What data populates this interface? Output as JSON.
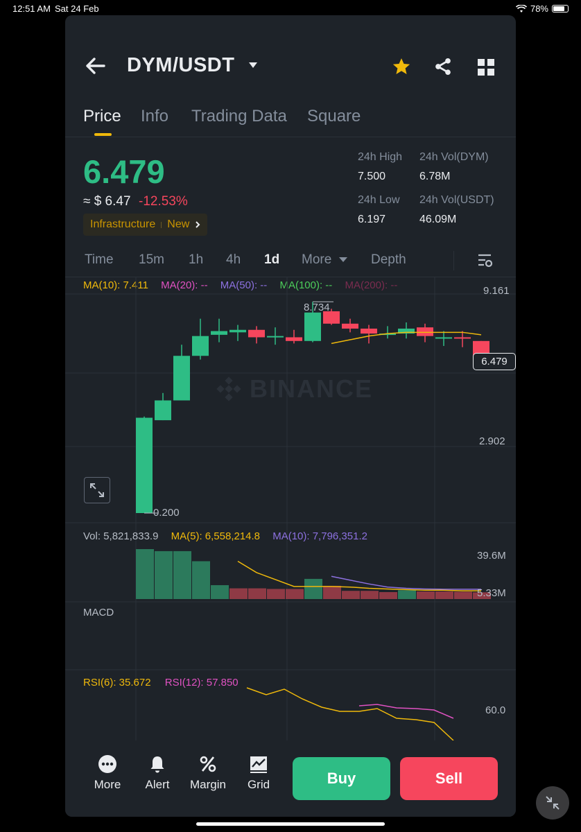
{
  "status": {
    "time": "12:51 AM",
    "date": "Sat 24 Feb",
    "battery": "78%"
  },
  "header": {
    "pair": "DYM/USDT"
  },
  "tabs": [
    "Price",
    "Info",
    "Trading Data",
    "Square"
  ],
  "ticker": {
    "price": "6.479",
    "approx": "≈ $ 6.47",
    "change": "-12.53%",
    "tag_category": "Infrastructure",
    "tag_new": "New",
    "stats": {
      "high_label": "24h High",
      "high_value": "7.500",
      "low_label": "24h Low",
      "low_value": "6.197",
      "vol_base_label": "24h Vol(DYM)",
      "vol_base_value": "6.78M",
      "vol_quote_label": "24h Vol(USDT)",
      "vol_quote_value": "46.09M"
    }
  },
  "timeframes": {
    "time": "Time",
    "m15": "15m",
    "h1": "1h",
    "h4": "4h",
    "d1": "1d",
    "more": "More",
    "depth": "Depth"
  },
  "ma": {
    "ma10": "MA(10): 7.411",
    "ma20": "MA(20): --",
    "ma50": "MA(50): --",
    "ma100": "MA(100): --",
    "ma200": "MA(200): --"
  },
  "chart_labels": {
    "axis_top": "9.161",
    "axis_mid": "2.902",
    "current_price": "6.479",
    "max_marker": "8.734",
    "min_marker": "0.200",
    "watermark": "BINANCE"
  },
  "volume": {
    "vol": "Vol: 5,821,833.9",
    "ma5": "MA(5): 6,558,214.8",
    "ma10": "MA(10): 7,796,351.2",
    "axis_top": "39.6M",
    "axis_bottom": "5.33M"
  },
  "macd": {
    "label": "MACD"
  },
  "rsi": {
    "rsi6": "RSI(6): 35.672",
    "rsi12": "RSI(12): 57.850",
    "axis": "60.0"
  },
  "footer": {
    "more": "More",
    "alert": "Alert",
    "margin": "Margin",
    "grid": "Grid",
    "buy": "Buy",
    "sell": "Sell"
  },
  "colors": {
    "up": "#2ebd85",
    "down": "#f6465d",
    "accent": "#f0b90b",
    "panel": "#1e2329"
  },
  "chart_data": {
    "type": "candlestick",
    "title": "",
    "candles": [
      {
        "o": 0.2,
        "h": 4.1,
        "l": 0.2,
        "c": 4.05
      },
      {
        "o": 3.95,
        "h": 5.05,
        "l": 3.95,
        "c": 4.75
      },
      {
        "o": 4.75,
        "h": 7.0,
        "l": 4.75,
        "c": 6.55
      },
      {
        "o": 6.55,
        "h": 8.05,
        "l": 6.4,
        "c": 7.35
      },
      {
        "o": 7.4,
        "h": 8.05,
        "l": 7.1,
        "c": 7.55
      },
      {
        "o": 7.5,
        "h": 7.8,
        "l": 7.15,
        "c": 7.6
      },
      {
        "o": 7.6,
        "h": 7.75,
        "l": 7.05,
        "c": 7.3
      },
      {
        "o": 7.3,
        "h": 7.7,
        "l": 7.0,
        "c": 7.35
      },
      {
        "o": 7.3,
        "h": 7.6,
        "l": 7.05,
        "c": 7.15
      },
      {
        "o": 7.15,
        "h": 8.73,
        "l": 7.1,
        "c": 8.3
      },
      {
        "o": 8.35,
        "h": 8.45,
        "l": 7.8,
        "c": 7.85
      },
      {
        "o": 7.85,
        "h": 8.05,
        "l": 7.5,
        "c": 7.65
      },
      {
        "o": 7.65,
        "h": 7.8,
        "l": 7.05,
        "c": 7.45
      },
      {
        "o": 7.45,
        "h": 7.75,
        "l": 7.25,
        "c": 7.45
      },
      {
        "o": 7.45,
        "h": 7.9,
        "l": 7.25,
        "c": 7.65
      },
      {
        "o": 7.7,
        "h": 7.85,
        "l": 7.1,
        "c": 7.35
      },
      {
        "o": 7.3,
        "h": 7.55,
        "l": 6.95,
        "c": 7.3
      },
      {
        "o": 7.3,
        "h": 7.55,
        "l": 6.9,
        "c": 7.25
      },
      {
        "o": 7.15,
        "h": 7.15,
        "l": 6.2,
        "c": 6.48
      }
    ],
    "ma10": [
      null,
      null,
      null,
      null,
      null,
      null,
      null,
      null,
      null,
      null,
      7.05,
      7.2,
      7.35,
      7.45,
      7.5,
      7.5,
      7.5,
      7.5,
      7.4
    ],
    "volume": [
      {
        "v": 39.6,
        "up": true
      },
      {
        "v": 38.0,
        "up": true
      },
      {
        "v": 38.0,
        "up": true
      },
      {
        "v": 30.0,
        "up": true
      },
      {
        "v": 11.0,
        "up": true
      },
      {
        "v": 8.5,
        "up": false
      },
      {
        "v": 8.5,
        "up": false
      },
      {
        "v": 8.0,
        "up": false
      },
      {
        "v": 8.0,
        "up": false
      },
      {
        "v": 16.0,
        "up": true
      },
      {
        "v": 10.5,
        "up": false
      },
      {
        "v": 6.5,
        "up": false
      },
      {
        "v": 6.5,
        "up": false
      },
      {
        "v": 5.5,
        "up": false
      },
      {
        "v": 7.0,
        "up": true
      },
      {
        "v": 6.0,
        "up": false
      },
      {
        "v": 6.0,
        "up": false
      },
      {
        "v": 5.8,
        "up": false
      },
      {
        "v": 5.33,
        "up": false
      }
    ],
    "vol_ma5": [
      null,
      null,
      null,
      null,
      null,
      30.0,
      21.0,
      15.5,
      10.0,
      10.0,
      10.0,
      9.5,
      8.5,
      8.0,
      7.5,
      7.0,
      7.0,
      6.5,
      6.5
    ],
    "vol_ma10": [
      null,
      null,
      null,
      null,
      null,
      null,
      null,
      null,
      null,
      null,
      18.0,
      15.0,
      12.0,
      9.5,
      8.5,
      8.0,
      7.8,
      7.8,
      7.8
    ],
    "rsi6": [
      null,
      null,
      null,
      null,
      null,
      null,
      null,
      null,
      null,
      null,
      null,
      null,
      null,
      null,
      null,
      null,
      null,
      null,
      null
    ],
    "price_axis": {
      "top": 9.161,
      "mid": 2.902
    },
    "vol_axis": {
      "top": 39.6,
      "bottom": 5.33
    },
    "rsi_axis": {
      "label": 60.0
    }
  }
}
